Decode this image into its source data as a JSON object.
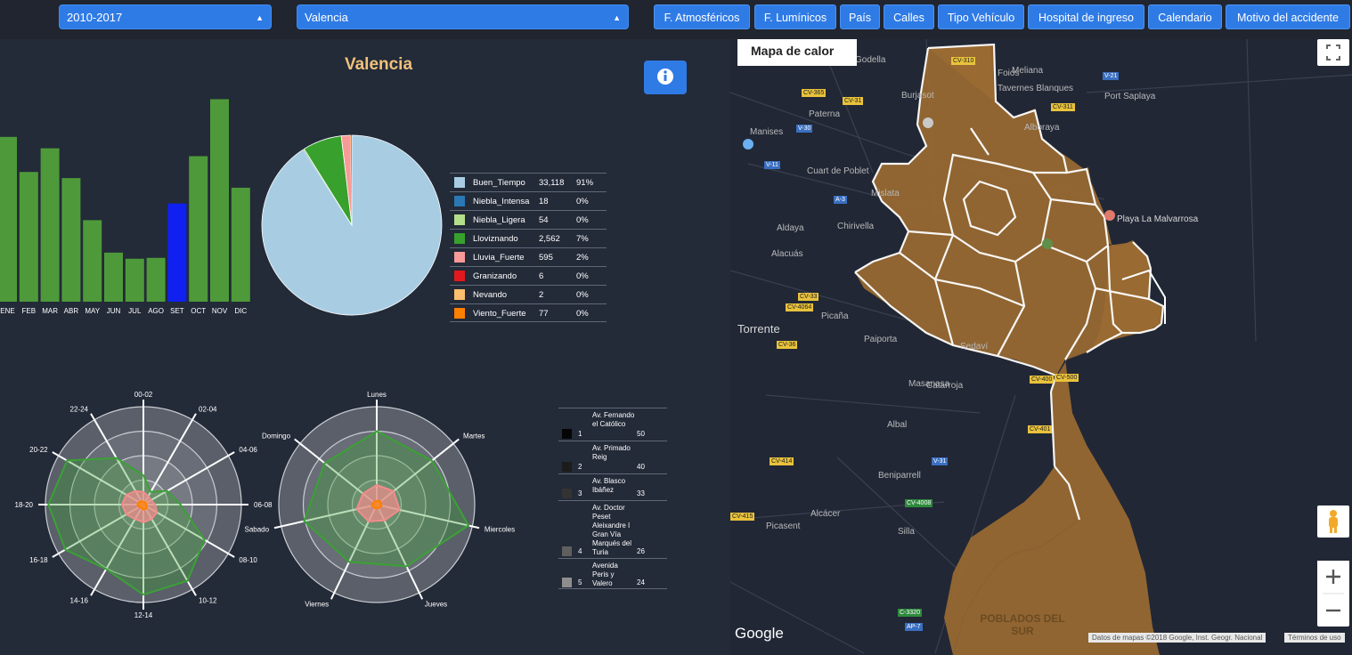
{
  "toolbar": {
    "period": "2010-2017",
    "city": "Valencia",
    "nav": [
      "F. Atmosféricos",
      "F. Lumínicos",
      "País",
      "Calles",
      "Tipo Vehículo",
      "Hospital de ingreso",
      "Calendario",
      "Motivo del accidente"
    ]
  },
  "panel": {
    "title": "Valencia",
    "info_icon": "info-circle-icon"
  },
  "colors": {
    "accent": "#2f7be6",
    "bar": "#4e9a3a",
    "bar_highlight": "#1020f0",
    "title": "#f0c27a",
    "map_fill": "#9a6a32"
  },
  "chart_data": [
    {
      "type": "bar",
      "title": "",
      "categories": [
        "ENE",
        "FEB",
        "MAR",
        "ABR",
        "MAY",
        "JUN",
        "JUL",
        "AGO",
        "SET",
        "OCT",
        "NOV",
        "DIC"
      ],
      "values": [
        188,
        148,
        175,
        141,
        93,
        56,
        49,
        50,
        112,
        166,
        231,
        130
      ],
      "highlighted": "SET",
      "ylim": [
        0,
        240
      ],
      "grid": false
    },
    {
      "type": "pie",
      "legend": "right",
      "slices": [
        {
          "label": "Buen_Tiempo",
          "count": "33,118",
          "pct": "91%",
          "value": 33118,
          "color": "#a8cde3"
        },
        {
          "label": "Niebla_Intensa",
          "count": "18",
          "pct": "0%",
          "value": 18,
          "color": "#2a78b4"
        },
        {
          "label": "Niebla_Ligera",
          "count": "54",
          "pct": "0%",
          "value": 54,
          "color": "#b4df8a"
        },
        {
          "label": "Lloviznando",
          "count": "2,562",
          "pct": "7%",
          "value": 2562,
          "color": "#38a02c"
        },
        {
          "label": "Lluvia_Fuerte",
          "count": "595",
          "pct": "2%",
          "value": 595,
          "color": "#f89a98"
        },
        {
          "label": "Granizando",
          "count": "6",
          "pct": "0%",
          "value": 6,
          "color": "#e2191c"
        },
        {
          "label": "Nevando",
          "count": "2",
          "pct": "0%",
          "value": 2,
          "color": "#fbbe6f"
        },
        {
          "label": "Viento_Fuerte",
          "count": "77",
          "pct": "0%",
          "value": 77,
          "color": "#ff7f00"
        }
      ]
    },
    {
      "type": "radar",
      "axes": [
        "00-02",
        "02-04",
        "04-06",
        "06-08",
        "08-10",
        "10-12",
        "12-14",
        "14-16",
        "16-18",
        "18-20",
        "20-22",
        "22-24"
      ],
      "rmax": 1,
      "series": [
        {
          "values": [
            0.3,
            0.15,
            0.28,
            0.38,
            0.72,
            0.9,
            0.92,
            0.76,
            0.92,
            0.97,
            0.9,
            0.55
          ],
          "color": "#3ba135"
        },
        {
          "values": [
            0.13,
            0.1,
            0.09,
            0.12,
            0.16,
            0.17,
            0.18,
            0.17,
            0.2,
            0.22,
            0.2,
            0.16
          ],
          "color": "#f28b8b"
        },
        {
          "values": [
            0.03,
            0.03,
            0.03,
            0.03,
            0.04,
            0.05,
            0.05,
            0.04,
            0.05,
            0.06,
            0.05,
            0.04
          ],
          "color": "#ff7f00"
        }
      ]
    },
    {
      "type": "radar",
      "axes": [
        "Lunes",
        "Martes",
        "Miercoles",
        "Jueves",
        "Viernes",
        "Sabado",
        "Domingo"
      ],
      "rmax": 1,
      "series": [
        {
          "values": [
            0.75,
            0.72,
            0.96,
            0.7,
            0.65,
            0.76,
            0.68
          ],
          "color": "#3ba135"
        },
        {
          "values": [
            0.2,
            0.22,
            0.24,
            0.18,
            0.19,
            0.21,
            0.18
          ],
          "color": "#f28b8b"
        },
        {
          "values": [
            0.04,
            0.05,
            0.05,
            0.04,
            0.04,
            0.05,
            0.04
          ],
          "color": "#ff7f00"
        }
      ]
    }
  ],
  "streets": [
    {
      "rank": "1",
      "name": "Av. Fernando el Católico",
      "count": "50",
      "color": "#050505"
    },
    {
      "rank": "2",
      "name": "Av. Primado Reig",
      "count": "40",
      "color": "#1c1c1c"
    },
    {
      "rank": "3",
      "name": "Av. Blasco Ibáñez",
      "count": "33",
      "color": "#333333"
    },
    {
      "rank": "4",
      "name": "Av. Doctor Peset Aleixandre I Gran Vía Marqués del Turia",
      "count": "26",
      "color": "#5f5f5f"
    },
    {
      "rank": "5",
      "name": "Avenida Peris y Valero",
      "count": "24",
      "color": "#8e8e8e"
    }
  ],
  "map": {
    "type_label": "Mapa de calor",
    "labels": [
      "Godella",
      "Burjasot",
      "Paterna",
      "Manises",
      "Cuart de Poblet",
      "Mislata",
      "Aldaya",
      "Chirivella",
      "Alacuás",
      "Torrente",
      "Picaña",
      "Paiporta",
      "Sedaví",
      "Masanasa",
      "Catarroja",
      "Albal",
      "Beniparrell",
      "Alcácer",
      "Picasent",
      "Silla",
      "Port Saplaya",
      "Playa La Malvarrosa",
      "POBLADOS DEL SUR",
      "Tavernes Blanques",
      "Foios",
      "Alboraya",
      "Meliana"
    ],
    "roads": [
      "CV-310",
      "CV-365",
      "CV-31",
      "V-21",
      "CV-311",
      "V-30",
      "V-11",
      "A-3",
      "CV-33",
      "CV-4064",
      "CV-36",
      "CV-400",
      "CV-401",
      "CV-414",
      "CV-4008",
      "CV-415",
      "C-3320",
      "AP-7",
      "V-31",
      "CV-500"
    ],
    "google": "Google",
    "attribution": "Datos de mapas ©2018 Google, Inst. Geogr. Nacional",
    "terms": "Términos de uso",
    "controls": [
      "fullscreen-icon",
      "pegman-icon",
      "zoom-in-icon",
      "zoom-out-icon"
    ]
  }
}
